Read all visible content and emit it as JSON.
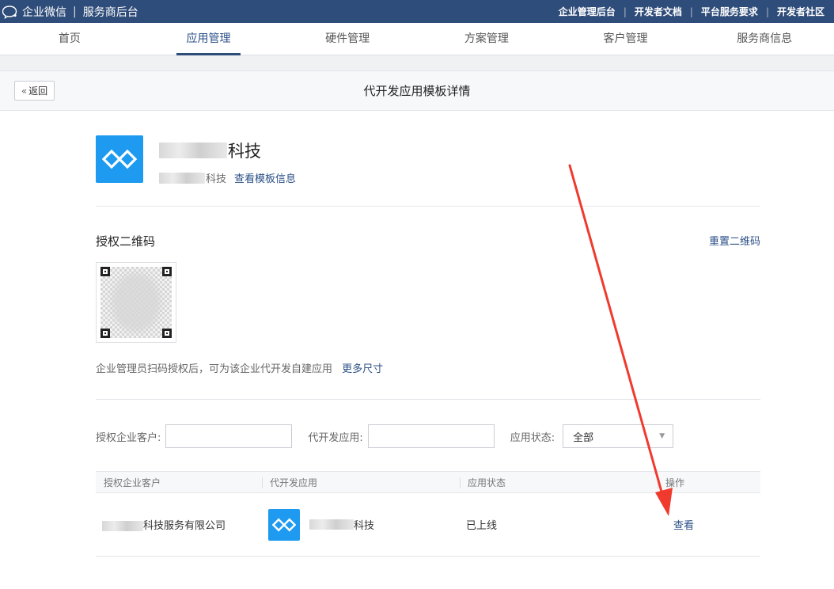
{
  "topbar": {
    "brand": "企业微信",
    "section": "服务商后台",
    "links": [
      "企业管理后台",
      "开发者文档",
      "平台服务要求",
      "开发者社区"
    ]
  },
  "nav": {
    "items": [
      "首页",
      "应用管理",
      "硬件管理",
      "方案管理",
      "客户管理",
      "服务商信息"
    ],
    "active_index": 1
  },
  "page": {
    "back_label": "返回",
    "title": "代开发应用模板详情"
  },
  "app": {
    "name_suffix": "科技",
    "sub_suffix": "科技",
    "view_template_info": "查看模板信息"
  },
  "qr": {
    "title": "授权二维码",
    "reset": "重置二维码",
    "description": "企业管理员扫码授权后，可为该企业代开发自建应用",
    "more_sizes": "更多尺寸"
  },
  "filters": {
    "customer_label": "授权企业客户:",
    "customer_value": "",
    "app_label": "代开发应用:",
    "app_value": "",
    "status_label": "应用状态:",
    "status_selected": "全部"
  },
  "table": {
    "headers": [
      "授权企业客户",
      "代开发应用",
      "应用状态",
      "操作"
    ],
    "rows": [
      {
        "customer_suffix": "科技服务有限公司",
        "app_suffix": "科技",
        "status": "已上线",
        "action": "查看"
      }
    ]
  },
  "colors": {
    "topbar": "#2f4d7a",
    "link": "#2a4f86",
    "app_logo": "#1e9bf0",
    "annotation_arrow": "#f03a2e"
  },
  "icons": {
    "brand": "chat-bubble-icon",
    "back": "double-chevron-left-icon",
    "app_logo": "linked-diamonds-icon",
    "select": "caret-down-icon"
  }
}
